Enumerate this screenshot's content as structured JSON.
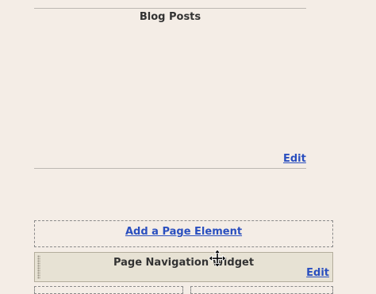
{
  "blog_posts": {
    "title": "Blog Posts",
    "edit_label": "Edit"
  },
  "add_element": {
    "label": "Add a Page Element"
  },
  "page_navigation_widget": {
    "title": "Page Navigation Widget",
    "edit_label": "Edit"
  },
  "cursor": {
    "icon": "move-cursor-icon"
  }
}
